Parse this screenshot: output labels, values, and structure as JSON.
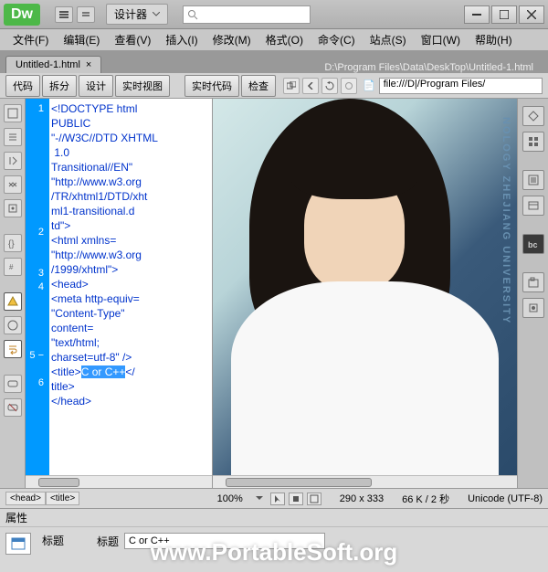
{
  "app": {
    "logo": "Dw"
  },
  "workspace": {
    "label": "设计器"
  },
  "search": {
    "placeholder": ""
  },
  "menu": {
    "items": [
      "文件(F)",
      "编辑(E)",
      "查看(V)",
      "插入(I)",
      "修改(M)",
      "格式(O)",
      "命令(C)",
      "站点(S)",
      "窗口(W)",
      "帮助(H)"
    ]
  },
  "tab": {
    "label": "Untitled-1.html",
    "path": "D:\\Program Files\\Data\\DeskTop\\Untitled-1.html"
  },
  "views": {
    "code": "代码",
    "split": "拆分",
    "design": "设计",
    "live": "实时视图",
    "livecode": "实时代码",
    "inspect": "检查"
  },
  "addressbar": {
    "prefix": "file:///D|/Program Files/"
  },
  "code_lines": {
    "gutter_line1": "1",
    "gutter_line2": "2",
    "gutter_line3": "3",
    "gutter_line4": "4",
    "gutter_line5": "5",
    "gutter_line6": "6",
    "line1": "<!DOCTYPE html\nPUBLIC\n\"-//W3C//DTD XHTML\n 1.0\nTransitional//EN\"\n\"http://www.w3.org\n/TR/xhtml1/DTD/xht\nml1-transitional.d\ntd\">",
    "line2": "<html xmlns=\n\"http://www.w3.org\n/1999/xhtml\">",
    "line3": "<head>",
    "line4": "<meta http-equiv=\n\"Content-Type\"\ncontent=\n\"text/html;\ncharset=utf-8\" />",
    "line5_open": "<title>",
    "line5_selected": "C or C++",
    "line5_close": "</\ntitle>",
    "line6": "</head>"
  },
  "preview": {
    "vtext": "NOLOGY ZHEJIANG UNIVERSITY"
  },
  "status": {
    "tagpath": [
      "<head>",
      "<title>"
    ],
    "zoom": "100%",
    "dimensions": "290 x 333",
    "filesize": "66 K / 2 秒",
    "encoding": "Unicode (UTF-8)"
  },
  "props": {
    "header": "属性",
    "type_label": "标题",
    "field_label": "标题",
    "field_value": "C or C++"
  },
  "watermark": "www.PortableSoft.org"
}
